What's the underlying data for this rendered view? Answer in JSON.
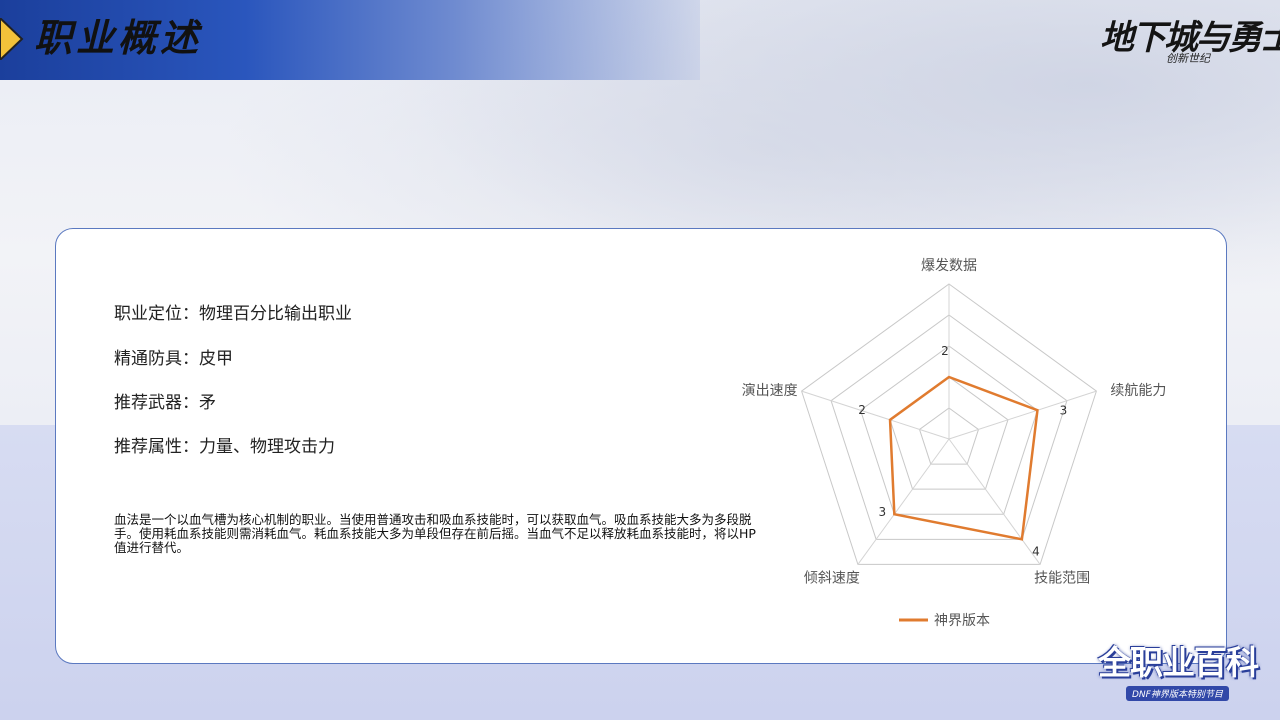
{
  "header": {
    "title": "职业概述",
    "game_logo": "地下城与勇士",
    "game_logo_sub": "创新世纪"
  },
  "profile": {
    "rows": [
      {
        "label": "职业定位：",
        "value": "物理百分比输出职业"
      },
      {
        "label": "精通防具：",
        "value": "皮甲"
      },
      {
        "label": "推荐武器：",
        "value": "矛"
      },
      {
        "label": "推荐属性：",
        "value": "力量、物理攻击力"
      }
    ],
    "description": "血法是一个以血气槽为核心机制的职业。当使用普通攻击和吸血系技能时，可以获取血气。吸血系技能大多为多段脱手。使用耗血系技能则需消耗血气。耗血系技能大多为单段但存在前后摇。当血气不足以释放耗血系技能时，将以HP值进行替代。"
  },
  "chart_data": {
    "type": "radar",
    "axes": [
      "爆发数据",
      "续航能力",
      "技能范围",
      "倾斜速度",
      "演出速度"
    ],
    "scale_max": 5,
    "rings": 5,
    "series": [
      {
        "name": "神界版本",
        "values": [
          2,
          3,
          4,
          3,
          2
        ],
        "color": "#e07b2f"
      }
    ],
    "value_labels": [
      "2",
      "3",
      "4",
      "3",
      "2"
    ],
    "legend_position": "bottom",
    "grid": true
  },
  "footer": {
    "event_logo": "全职业百科",
    "event_logo_sub": "DNF神界版本特别节目"
  }
}
